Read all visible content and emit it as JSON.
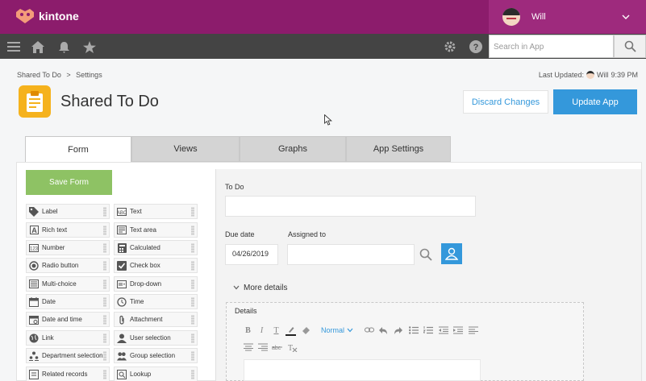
{
  "header": {
    "app_name": "kintone",
    "user_name": "Will"
  },
  "nav": {
    "search_placeholder": "Search in App"
  },
  "breadcrumb": {
    "app": "Shared To Do",
    "separator": ">",
    "current": "Settings"
  },
  "last_updated": {
    "label": "Last Updated:",
    "user": "Will",
    "time": "9:39 PM"
  },
  "app": {
    "title": "Shared To Do"
  },
  "actions": {
    "discard": "Discard Changes",
    "update": "Update App"
  },
  "tabs": [
    "Form",
    "Views",
    "Graphs",
    "App Settings"
  ],
  "save_form": "Save Form",
  "palette": [
    {
      "label": "Label",
      "icon": "tag-icon"
    },
    {
      "label": "Text",
      "icon": "text-field-icon"
    },
    {
      "label": "Rich text",
      "icon": "rich-text-icon"
    },
    {
      "label": "Text area",
      "icon": "text-area-icon"
    },
    {
      "label": "Number",
      "icon": "number-icon"
    },
    {
      "label": "Calculated",
      "icon": "calculator-icon"
    },
    {
      "label": "Radio button",
      "icon": "radio-icon"
    },
    {
      "label": "Check box",
      "icon": "checkbox-icon"
    },
    {
      "label": "Multi-choice",
      "icon": "multi-choice-icon"
    },
    {
      "label": "Drop-down",
      "icon": "dropdown-icon"
    },
    {
      "label": "Date",
      "icon": "calendar-icon"
    },
    {
      "label": "Time",
      "icon": "clock-icon"
    },
    {
      "label": "Date and time",
      "icon": "calendar-clock-icon"
    },
    {
      "label": "Attachment",
      "icon": "paperclip-icon"
    },
    {
      "label": "Link",
      "icon": "globe-icon"
    },
    {
      "label": "User selection",
      "icon": "user-icon"
    },
    {
      "label": "Department selection",
      "icon": "department-icon"
    },
    {
      "label": "Group selection",
      "icon": "group-icon"
    },
    {
      "label": "Related records",
      "icon": "related-records-icon"
    },
    {
      "label": "Lookup",
      "icon": "lookup-icon"
    }
  ],
  "form": {
    "todo_label": "To Do",
    "due_date_label": "Due date",
    "due_date_value": "04/26/2019",
    "assigned_to_label": "Assigned to",
    "more_details": "More details",
    "details_label": "Details",
    "format_select": "Normal"
  },
  "colors": {
    "brand": "#8c1c6c",
    "accent": "#3498db",
    "save": "#8ec264",
    "app_icon": "#f5b21d"
  }
}
